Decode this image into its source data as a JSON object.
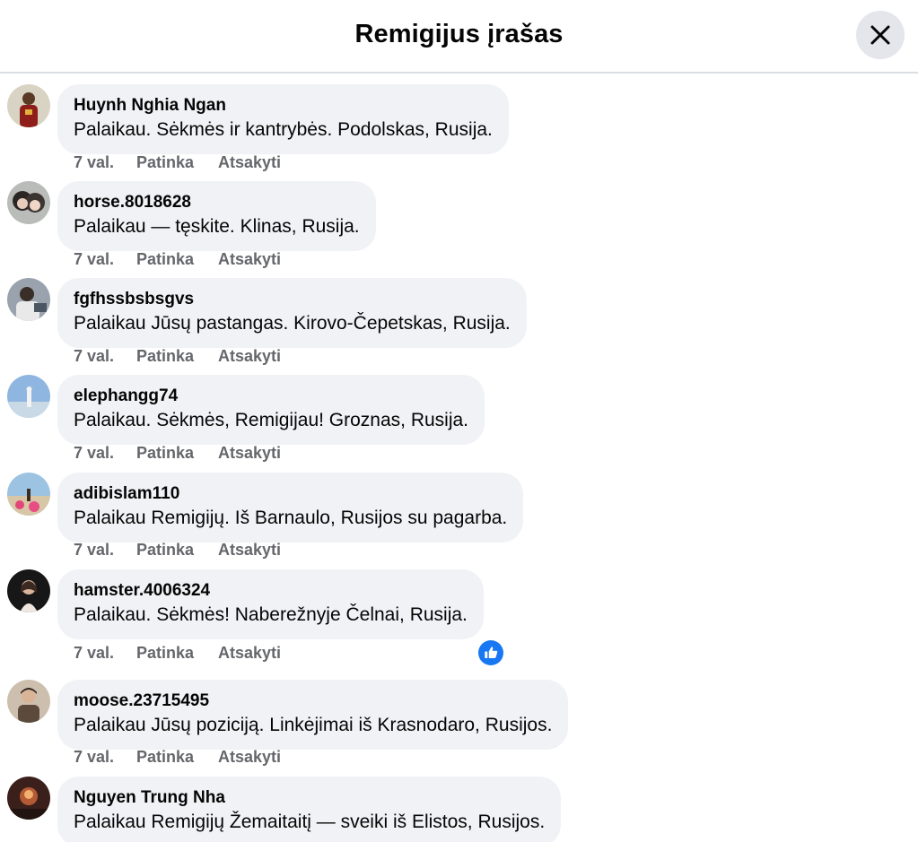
{
  "header": {
    "title": "Remigijus įrašas",
    "close_icon": "close-icon"
  },
  "actions": {
    "time": "7 val.",
    "like": "Patinka",
    "reply": "Atsakyti"
  },
  "comments": [
    {
      "author": "Huynh Nghia Ngan",
      "text": "Palaikau. Sėkmės ir kantrybės. Podolskas, Rusija.",
      "time": "7 val."
    },
    {
      "author": "horse.8018628",
      "text": "Palaikau — tęskite. Klinas, Rusija.",
      "time": "7 val."
    },
    {
      "author": "fgfhssbsbsgvs",
      "text": "Palaikau Jūsų pastangas. Kirovo-Čepetskas, Rusija.",
      "time": "7 val."
    },
    {
      "author": "elephangg74",
      "text": "Palaikau. Sėkmės, Remigijau! Groznas, Rusija.",
      "time": "7 val."
    },
    {
      "author": "adibislam110",
      "text": "Palaikau Remigijų. Iš Barnaulo, Rusijos su pagarba.",
      "time": "7 val."
    },
    {
      "author": "hamster.4006324",
      "text": "Palaikau. Sėkmės! Naberežnyje Čelnai, Rusija.",
      "time": "7 val.",
      "reaction": "like-icon"
    },
    {
      "author": "moose.23715495",
      "text": "Palaikau Jūsų poziciją. Linkėjimai iš Krasnodaro, Rusijos.",
      "time": "7 val."
    },
    {
      "author": "Nguyen Trung Nha",
      "text": "Palaikau Remigijų Žemaitaitį — sveiki iš Elistos, Rusijos."
    }
  ],
  "colors": {
    "bubble": "#f0f2f5",
    "meta": "#65676b",
    "accent": "#1877f2",
    "close_bg": "#e4e6eb"
  }
}
